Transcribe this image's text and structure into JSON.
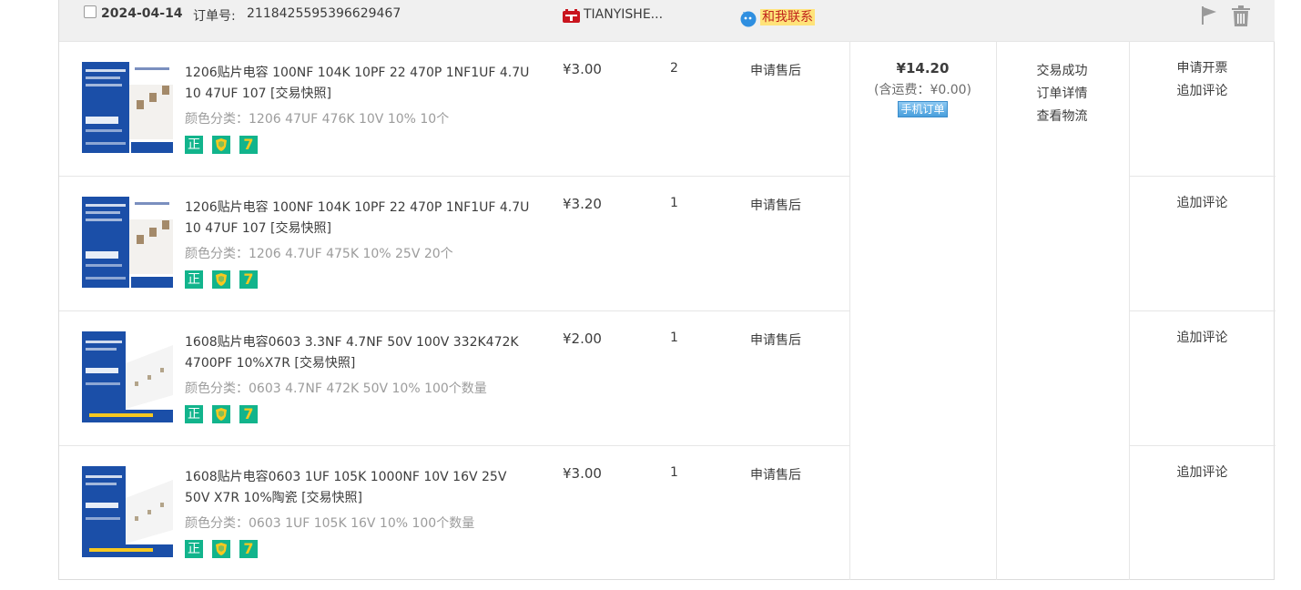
{
  "order": {
    "date": "2024-04-14",
    "order_no_label": "订单号:",
    "order_no": "2118425595396629467",
    "shop_name": "TIANYISHE...",
    "contact_label": "和我联系",
    "total": "¥14.20",
    "shipping": "(含运费：¥0.00)",
    "mobile_badge": "手机订单",
    "status_lines": [
      "交易成功",
      "订单详情",
      "查看物流"
    ]
  },
  "items": [
    {
      "title": "1206贴片电容 100NF 104K 10PF 22 470P 1NF1UF 4.7U 10 47UF 107 [交易快照]",
      "sku": "颜色分类：1206 47UF 476K 10V 10% 10个",
      "price": "¥3.00",
      "qty": "2",
      "aftersale": "申请售后",
      "ops": [
        "申请开票",
        "追加评论"
      ]
    },
    {
      "title": "1206贴片电容 100NF 104K 10PF 22 470P 1NF1UF 4.7U 10 47UF 107 [交易快照]",
      "sku": "颜色分类：1206 4.7UF 475K 10% 25V 20个",
      "price": "¥3.20",
      "qty": "1",
      "aftersale": "申请售后",
      "ops": [
        "追加评论"
      ]
    },
    {
      "title": "1608贴片电容0603 3.3NF 4.7NF 50V 100V 332K472K 4700PF 10%X7R [交易快照]",
      "sku": "颜色分类：0603 4.7NF 472K 50V 10% 100个数量",
      "price": "¥2.00",
      "qty": "1",
      "aftersale": "申请售后",
      "ops": [
        "追加评论"
      ]
    },
    {
      "title": "1608贴片电容0603 1UF 105K 1000NF 10V 16V 25V 50V X7R 10%陶瓷 [交易快照]",
      "sku": "颜色分类：0603 1UF 105K 16V 10% 100个数量",
      "price": "¥3.00",
      "qty": "1",
      "aftersale": "申请售后",
      "ops": [
        "追加评论"
      ]
    }
  ],
  "badges": {
    "genuine": "正",
    "seven_day": "7"
  },
  "icons": {
    "tmall": "tmall-icon",
    "contact": "wangwang-bubble-icon",
    "flag": "flag-icon",
    "trash": "trash-icon",
    "shield": "guarantee-shield-icon"
  },
  "colors": {
    "header_bg": "#f0f0f0",
    "badge_green": "#12b48c",
    "badge_yellow": "#f7c81f",
    "contact_bg": "#ffe37a",
    "mobile_blue": "#4a9fdc"
  }
}
